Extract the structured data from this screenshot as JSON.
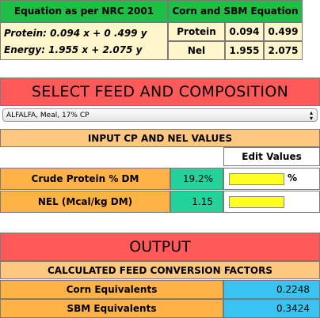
{
  "equations": {
    "nrc_header": "Equation as per NRC 2001",
    "protein_eq": "Protein: 0.094 x  +  0 .499 y",
    "energy_eq": "Energy: 1.955 x + 2.075 y",
    "corn_sbm_header": "Corn and SBM Equation",
    "rows": [
      {
        "label": "Protein",
        "x": "0.094",
        "y": "0.499"
      },
      {
        "label": "Nel",
        "x": "1.955",
        "y": "2.075"
      }
    ]
  },
  "select_feed": {
    "title": "SELECT FEED AND COMPOSITION",
    "selected": "ALFALFA, Meal, 17% CP"
  },
  "input": {
    "title": "INPUT CP AND NEL VALUES",
    "edit_header": "Edit Values",
    "rows": [
      {
        "label": "Crude Protein % DM",
        "value": "19.2%",
        "edit_value": "",
        "unit": "%"
      },
      {
        "label": "NEL (Mcal/kg DM)",
        "value": "1.15",
        "edit_value": "",
        "unit": ""
      }
    ]
  },
  "output": {
    "title": "OUTPUT",
    "subtitle": "CALCULATED FEED CONVERSION FACTORS",
    "rows": [
      {
        "label": "Corn Equivalents",
        "value": "0.2248"
      },
      {
        "label": "SBM Equivalents",
        "value": "0.3424"
      }
    ]
  },
  "colors": {
    "header_green": "#1fbf46",
    "equation_cream": "#fff6cc",
    "section_red": "#ff5a5a",
    "label_orange": "#ffb347",
    "value_teal": "#22d39a",
    "edit_yellow": "#ffff24",
    "output_blue": "#39c3f0"
  }
}
